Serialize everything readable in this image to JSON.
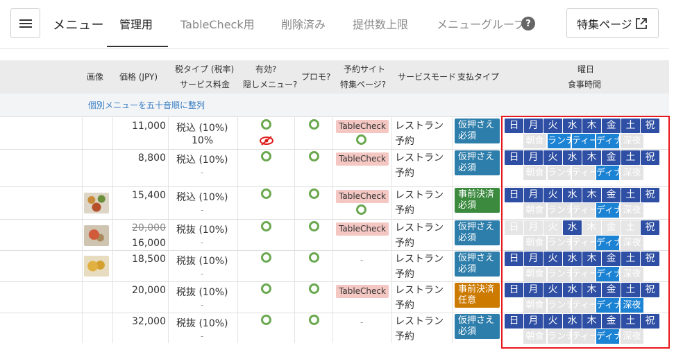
{
  "nav": {
    "title": "メニュー",
    "tabs": [
      {
        "label": "管理用",
        "active": true
      },
      {
        "label": "TableCheck用",
        "active": false
      },
      {
        "label": "削除済み",
        "active": false
      },
      {
        "label": "提供数上限",
        "active": false
      },
      {
        "label": "メニューグループ",
        "active": false
      }
    ],
    "help": "?",
    "feature_button": "特集ページ"
  },
  "table": {
    "headers": {
      "image": "画像",
      "price": "価格 (JPY)",
      "tax_1": "税タイプ (税率)",
      "tax_2": "サービス料金",
      "active_1": "有効?",
      "active_2": "隠しメニュー?",
      "promo": "プロモ?",
      "site_1": "予約サイト",
      "site_2": "特集ページ?",
      "service_mode": "サービスモード",
      "payment": "支払タイプ",
      "weekday_1": "曜日",
      "weekday_2": "食事時間"
    },
    "sort_link": "個別メニューを五十音順に整列",
    "day_labels": [
      "日",
      "月",
      "火",
      "水",
      "木",
      "金",
      "土",
      "祝日"
    ],
    "meal_labels": [
      "朝食",
      "ランチ",
      "ティー",
      "ディナ",
      "深夜"
    ],
    "rows": [
      {
        "price": "11,000",
        "old_price": "",
        "tax": "税込 (10%)",
        "service_fee": "10%",
        "hidden": true,
        "tablecheck": "TableCheck",
        "featured": true,
        "service_mode": "レストラン予約",
        "payment": "仮押さえ必須",
        "payment_color": "#2e7eab",
        "days": [
          1,
          1,
          1,
          1,
          1,
          1,
          1,
          1
        ],
        "meals": [
          0,
          1,
          1,
          1,
          0
        ]
      },
      {
        "price": "8,800",
        "old_price": "",
        "tax": "税込 (10%)",
        "service_fee": "-",
        "hidden": false,
        "tablecheck": "TableCheck",
        "featured": false,
        "service_mode": "レストラン予約",
        "payment": "仮押さえ必須",
        "payment_color": "#2e7eab",
        "days": [
          1,
          1,
          1,
          1,
          1,
          1,
          1,
          1
        ],
        "meals": [
          0,
          0,
          0,
          1,
          0
        ]
      },
      {
        "price": "15,400",
        "old_price": "",
        "tax": "税込 (10%)",
        "service_fee": "-",
        "hidden": false,
        "tablecheck": "TableCheck",
        "featured": true,
        "service_mode": "レストラン予約",
        "payment": "事前決済必須",
        "payment_color": "#3b8a3e",
        "days": [
          1,
          1,
          1,
          1,
          1,
          1,
          1,
          1
        ],
        "meals": [
          0,
          0,
          0,
          1,
          0
        ]
      },
      {
        "price": "16,000",
        "old_price": "20,000",
        "tax": "税抜 (10%)",
        "service_fee": "-",
        "hidden": false,
        "tablecheck": "TableCheck",
        "featured": false,
        "service_mode": "レストラン予約",
        "payment": "仮押さえ必須",
        "payment_color": "#2e7eab",
        "days": [
          0,
          0,
          0,
          1,
          0,
          0,
          0,
          1
        ],
        "meals": [
          0,
          0,
          0,
          1,
          0
        ]
      },
      {
        "price": "18,500",
        "old_price": "",
        "tax": "税抜 (10%)",
        "service_fee": "-",
        "hidden": false,
        "tablecheck": "-",
        "featured": false,
        "service_mode": "レストラン予約",
        "payment": "仮押さえ必須",
        "payment_color": "#2e7eab",
        "days": [
          1,
          1,
          1,
          1,
          1,
          1,
          1,
          1
        ],
        "meals": [
          0,
          0,
          0,
          1,
          0
        ]
      },
      {
        "price": "20,000",
        "old_price": "",
        "tax": "税抜 (10%)",
        "service_fee": "-",
        "hidden": false,
        "tablecheck": "TableCheck",
        "featured": false,
        "service_mode": "レストラン予約",
        "payment": "事前決済任意",
        "payment_color": "#cc7a00",
        "days": [
          1,
          1,
          1,
          1,
          1,
          1,
          1,
          1
        ],
        "meals": [
          0,
          0,
          0,
          1,
          1
        ]
      },
      {
        "price": "32,000",
        "old_price": "",
        "tax": "税抜 (10%)",
        "service_fee": "-",
        "hidden": false,
        "tablecheck": "-",
        "featured": false,
        "service_mode": "レストラン予約",
        "payment": "仮押さえ必須",
        "payment_color": "#2e7eab",
        "days": [
          1,
          1,
          1,
          1,
          1,
          1,
          1,
          1
        ],
        "meals": [
          0,
          0,
          0,
          1,
          0
        ]
      }
    ]
  }
}
